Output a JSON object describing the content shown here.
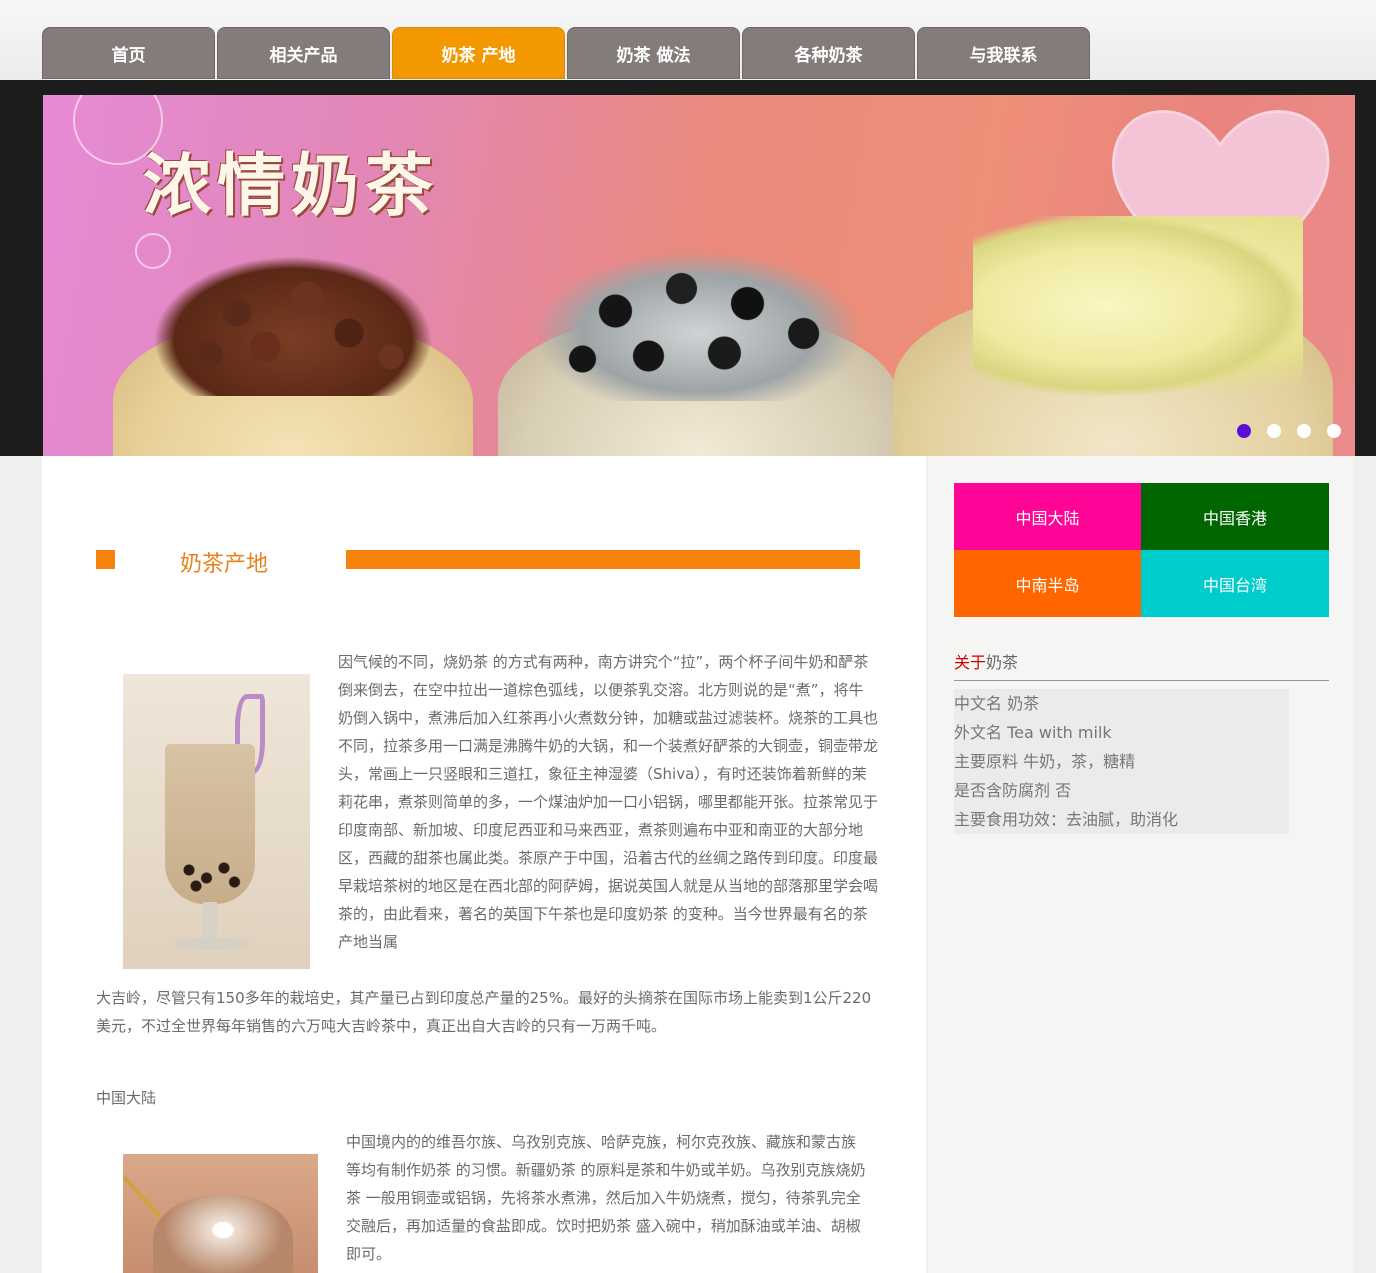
{
  "nav": {
    "items": [
      {
        "label": "首页"
      },
      {
        "label": "相关产品"
      },
      {
        "label": "奶茶 产地"
      },
      {
        "label": "奶茶 做法"
      },
      {
        "label": "各种奶茶"
      },
      {
        "label": "与我联系"
      }
    ],
    "active_index": 2,
    "active_color": "#f39800"
  },
  "banner": {
    "title": "浓情奶茶",
    "slide_count": 4,
    "active_slide": 1
  },
  "section": {
    "title": "奶茶产地"
  },
  "article": {
    "p1": "因气候的不同，烧奶茶 的方式有两种，南方讲究个“拉”，两个杯子间牛奶和酽茶倒来倒去，在空中拉出一道棕色弧线，以便茶乳交溶。北方则说的是“煮”，将牛奶倒入锅中，煮沸后加入红茶再小火煮数分钟，加糖或盐过滤装杯。烧茶的工具也不同，拉茶多用一口满是沸腾牛奶的大锅，和一个装煮好酽茶的大铜壶，铜壶带龙头，常画上一只竖眼和三道扛，象征主神湿婆（Shiva），有时还装饰着新鲜的茉莉花串，煮茶则简单的多，一个煤油炉加一口小铝锅，哪里都能开张。拉茶常见于印度南部、新加坡、印度尼西亚和马来西亚，煮茶则遍布中亚和南亚的大部分地区，西藏的甜茶也属此类。茶原产于中国，沿着古代的丝绸之路传到印度。印度最早栽培茶树的地区是在西北部的阿萨姆，据说英国人就是从当地的部落那里学会喝茶的，由此看来，著名的英国下午茶也是印度奶茶 的变种。当今世界最有名的茶产地当属",
    "p2": "大吉岭，尽管只有150多年的栽培史，其产量已占到印度总产量的25%。最好的头摘茶在国际市场上能卖到1公斤220美元，不过全世界每年销售的六万吨大吉岭茶中，真正出自大吉岭的只有一万两千吨。",
    "region_label": "中国大陆",
    "p3": "中国境内的的维吾尔族、乌孜别克族、哈萨克族，柯尔克孜族、藏族和蒙古族等均有制作奶茶 的习惯。新疆奶茶 的原料是茶和牛奶或羊奶。乌孜别克族烧奶茶 一般用铜壶或铝锅，先将茶水煮沸，然后加入牛奶烧煮，搅匀，待茶乳完全交融后，再加适量的食盐即成。饮时把奶茶 盛入碗中，稍加酥油或羊油、胡椒即可。"
  },
  "sidebar": {
    "tiles": [
      {
        "label": "中国大陆",
        "color": "#fe0497"
      },
      {
        "label": "中国香港",
        "color": "#006600"
      },
      {
        "label": "中南半岛",
        "color": "#ff6600"
      },
      {
        "label": "中国台湾",
        "color": "#00cccc"
      }
    ],
    "about_prefix": "关于",
    "about_suffix": "奶茶",
    "facts": [
      "中文名 奶茶",
      "外文名 Tea with milk",
      "主要原料 牛奶，茶，糖精",
      "是否含防腐剂 否",
      "主要食用功效：去油腻，助消化"
    ]
  }
}
